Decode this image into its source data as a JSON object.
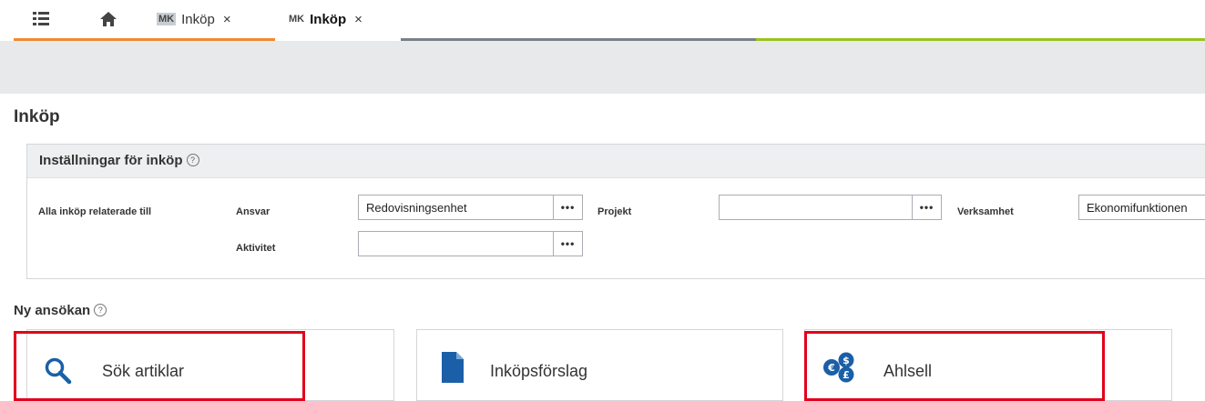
{
  "tabs": [
    {
      "badge": "MK",
      "label": "Inköp",
      "close": "×"
    },
    {
      "badge": "MK",
      "label": "Inköp",
      "close": "×"
    }
  ],
  "page": {
    "title": "Inköp"
  },
  "settings": {
    "title": "Inställningar för inköp",
    "help": "?",
    "row_label": "Alla inköp relaterade till",
    "fields": {
      "ansvar": {
        "label": "Ansvar",
        "value": "Redovisningsenhet"
      },
      "projekt": {
        "label": "Projekt",
        "value": ""
      },
      "verksamhet": {
        "label": "Verksamhet",
        "value": "Ekonomifunktionen"
      },
      "aktivitet": {
        "label": "Aktivitet",
        "value": ""
      }
    },
    "lookup_button": "•••"
  },
  "new_application": {
    "title": "Ny ansökan",
    "help": "?",
    "cards": [
      {
        "label": "Sök artiklar",
        "icon": "search-icon"
      },
      {
        "label": "Inköpsförslag",
        "icon": "document-icon"
      },
      {
        "label": "Ahlsell",
        "icon": "currency-icon"
      }
    ]
  },
  "colors": {
    "accent_orange": "#f28a2e",
    "line_grey": "#7a8089",
    "line_green": "#9bc31f",
    "highlight_red": "#e2001a",
    "icon_blue": "#1a5fa8"
  }
}
